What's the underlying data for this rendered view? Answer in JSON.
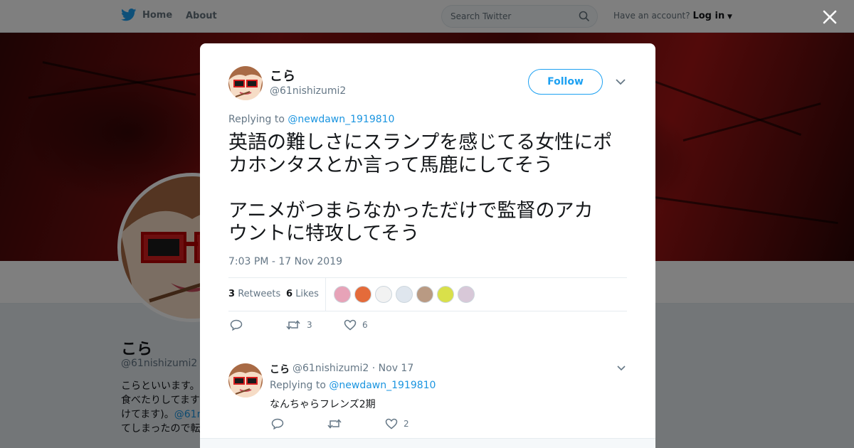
{
  "header": {
    "home_label": "Home",
    "about_label": "About",
    "search_placeholder": "Search Twitter",
    "account_prompt": "Have an account?",
    "login_label": "Log in"
  },
  "profile": {
    "name": "こら",
    "handle": "@61nishizumi2",
    "bio_lines": [
      {
        "text": "こらといいます。"
      },
      {
        "text": "食べたりしてます"
      },
      {
        "prefix": "けてます)。",
        "link": "@61n"
      },
      {
        "text": "てしまったので転"
      }
    ]
  },
  "tweet": {
    "author_name": "こら",
    "author_handle": "@61nishizumi2",
    "follow_label": "Follow",
    "replying_prefix": "Replying to",
    "replying_mention": "@newdawn_1919810",
    "text_lines": [
      "英語の難しさにスランプを感じてる女性にポ",
      "カホンタスとか言って馬鹿にしてそう",
      "",
      "アニメがつまらなかっただけで監督のアカ",
      "ウントに特攻してそう"
    ],
    "timestamp": "7:03 PM - 17 Nov 2019",
    "retweet_count": "3",
    "retweets_label": "Retweets",
    "like_count": "6",
    "likes_label": "Likes",
    "action_retweets": "3",
    "action_likes": "6"
  },
  "likers": [
    {
      "color": "#e7a3b8"
    },
    {
      "color": "#e46b3a"
    },
    {
      "color": "#f2f2f2"
    },
    {
      "color": "#dfe6ee"
    },
    {
      "color": "#b99a83"
    },
    {
      "color": "#d9e04a"
    },
    {
      "color": "#d8c8d8"
    }
  ],
  "reply": {
    "author_name": "こら",
    "author_handle": "@61nishizumi2",
    "separator": "·",
    "date": "Nov 17",
    "replying_prefix": "Replying to",
    "replying_mention": "@newdawn_1919810",
    "text": "なんちゃらフレンズ2期",
    "like_count": "2"
  },
  "colors": {
    "twitter_blue": "#1da1f2",
    "link_blue": "#1b95e0",
    "text_dark": "#14171a",
    "text_muted": "#657786"
  }
}
